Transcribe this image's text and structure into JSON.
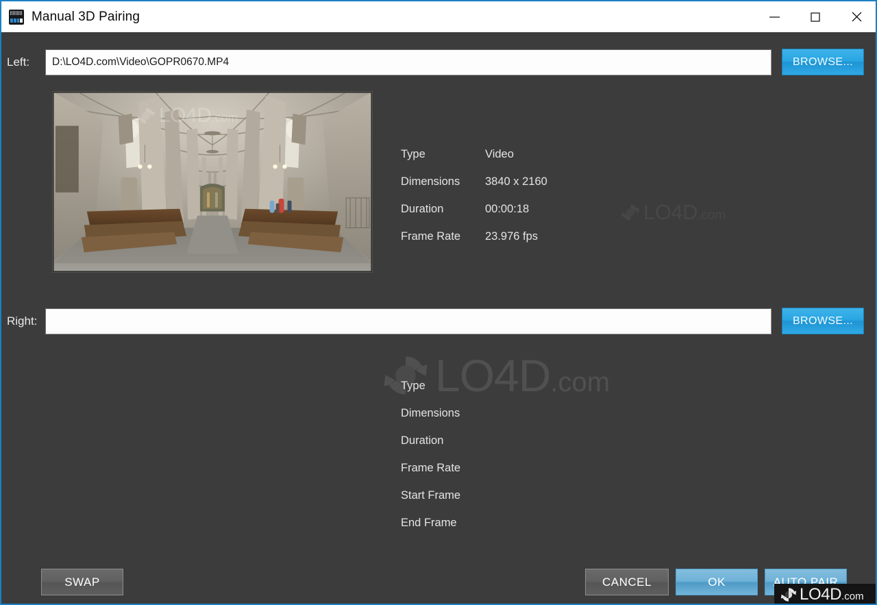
{
  "window": {
    "title": "Manual 3D Pairing",
    "app_icon": "gopro-app-icon",
    "controls": {
      "minimize": "minimize-icon",
      "maximize": "maximize-icon",
      "close": "close-icon"
    },
    "accent_color": "#1c7fc4",
    "background_color": "#3c3c3c"
  },
  "left": {
    "label": "Left:",
    "path_value": "D:\\LO4D.com\\Video\\GOPR0670.MP4",
    "path_placeholder": "",
    "browse_label": "BROWSE...",
    "thumbnail_alt": "cathedral-interior-fisheye-frame",
    "metadata": [
      {
        "key": "Type",
        "value": "Video"
      },
      {
        "key": "Dimensions",
        "value": "3840 x 2160"
      },
      {
        "key": "Duration",
        "value": "00:00:18"
      },
      {
        "key": "Frame Rate",
        "value": "23.976 fps"
      }
    ]
  },
  "right": {
    "label": "Right:",
    "path_value": "",
    "path_placeholder": "",
    "browse_label": "BROWSE...",
    "metadata": [
      {
        "key": "Type",
        "value": ""
      },
      {
        "key": "Dimensions",
        "value": ""
      },
      {
        "key": "Duration",
        "value": ""
      },
      {
        "key": "Frame Rate",
        "value": ""
      },
      {
        "key": "Start Frame",
        "value": ""
      },
      {
        "key": "End Frame",
        "value": ""
      }
    ]
  },
  "footer": {
    "swap_label": "SWAP",
    "cancel_label": "CANCEL",
    "ok_label": "OK",
    "auto_pair_label": "AUTO PAIR"
  },
  "watermark": {
    "brand_main": "LO4D",
    "brand_suffix": ".com",
    "logo": "lo4d-circular-arrows-logo"
  }
}
